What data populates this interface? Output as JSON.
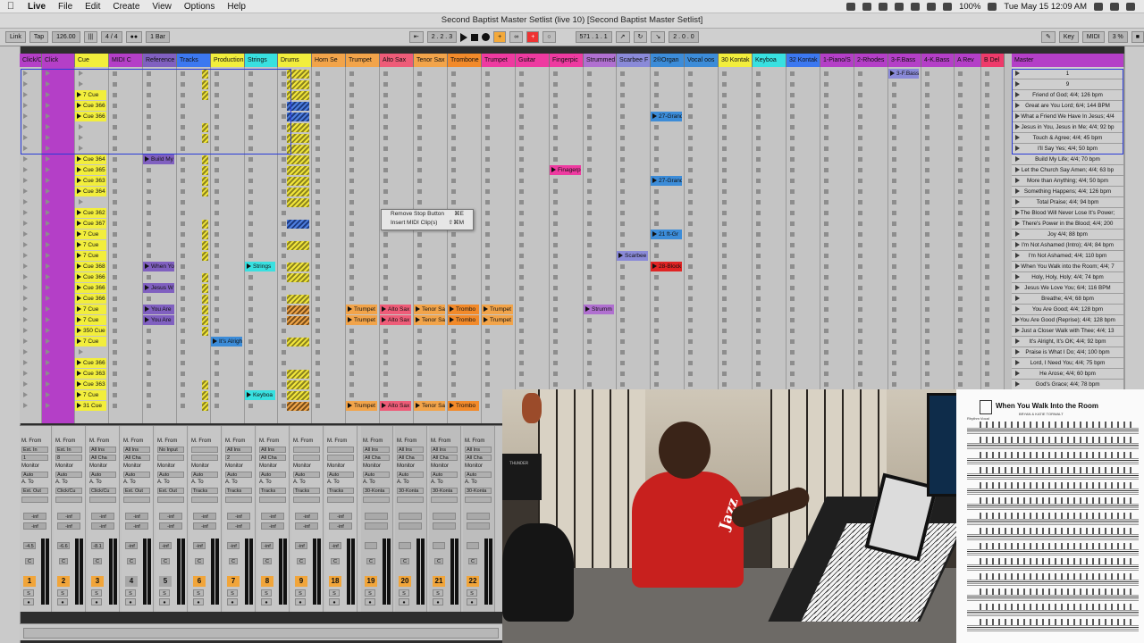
{
  "menubar": {
    "app": "Live",
    "items": [
      "File",
      "Edit",
      "Create",
      "View",
      "Options",
      "Help"
    ],
    "battery": "100%",
    "clock": "Tue May 15  12:09 AM"
  },
  "window_title": "Second Baptist Master Setlist  (live 10)  [Second Baptist Master Setlist]",
  "transport": {
    "link": "Link",
    "tap": "Tap",
    "tempo": "126.00",
    "signature": "4 / 4",
    "quantize": "1 Bar",
    "position": "2 .  2 .  3",
    "loop_start": "571 .  1 .  1",
    "loop_length": "2 .  0 .  0",
    "key": "Key",
    "midi": "MIDI",
    "cpu": "3 %"
  },
  "tracks": [
    {
      "name": "Click/C",
      "color": "#b43fc7"
    },
    {
      "name": "Click",
      "color": "#b43fc7"
    },
    {
      "name": "Cue",
      "color": "#f2ee3c"
    },
    {
      "name": "MIDI C",
      "color": "#b43fc7"
    },
    {
      "name": "Reference",
      "color": "#8060c0"
    },
    {
      "name": "Tracks",
      "color": "#3c78f0"
    },
    {
      "name": "Production",
      "color": "#f2ee3c"
    },
    {
      "name": "Strings",
      "color": "#38e0e0"
    },
    {
      "name": "Drums",
      "color": "#f2ee3c"
    },
    {
      "name": "Horn Se",
      "color": "#f2a44a"
    },
    {
      "name": "Trumpet",
      "color": "#f2a44a"
    },
    {
      "name": "Alto Sax",
      "color": "#ee5c78"
    },
    {
      "name": "Tenor Sax",
      "color": "#f2a44a"
    },
    {
      "name": "Trombone",
      "color": "#f28a2a"
    },
    {
      "name": "Trumpet",
      "color": "#ee3aa0"
    },
    {
      "name": "Guitar",
      "color": "#ee3aa0"
    },
    {
      "name": "Fingerpic",
      "color": "#ee3aa0"
    },
    {
      "name": "Strummed",
      "color": "#b070d0"
    },
    {
      "name": "Scarbee F",
      "color": "#8a8ad8"
    },
    {
      "name": "2®Organ",
      "color": "#3c8cd8"
    },
    {
      "name": "Vocal oos",
      "color": "#3c8cd8"
    },
    {
      "name": "30 Kontak",
      "color": "#f2ee3c"
    },
    {
      "name": "Keyboa",
      "color": "#38e0e0"
    },
    {
      "name": "32 Kontak",
      "color": "#3c78f0"
    },
    {
      "name": "1-Piano/S",
      "color": "#b43fc7"
    },
    {
      "name": "2-Rhodes",
      "color": "#b43fc7"
    },
    {
      "name": "3-F.Bass",
      "color": "#b43fc7"
    },
    {
      "name": "4-K.Bass",
      "color": "#b43fc7"
    },
    {
      "name": "A Rev",
      "color": "#b43fc7"
    },
    {
      "name": "B Del",
      "color": "#ee3a6a"
    },
    {
      "name": "Master",
      "color": "#b43fc7"
    }
  ],
  "clips": {
    "cue": [
      "7 Cue",
      "Cue 366",
      "Cue 366",
      "Cue 364",
      "Cue 365",
      "Cue 363",
      "Cue 364",
      "Cue 362",
      "Cue 367",
      "7 Cue",
      "7 Cue",
      "7 Cue",
      "Cue 368",
      "Cue 366",
      "Cue 366",
      "Cue 366",
      "7 Cue",
      "7 Cue",
      "350 Cue",
      "7 Cue",
      "Cue 366",
      "Cue 363",
      "Cue 363",
      "7 Cue",
      "31 Cue"
    ],
    "reference": [
      "Build My",
      "When Yo",
      "Jesus W",
      "You Are",
      "You Are"
    ],
    "production": "It's Alright",
    "strings": "Strings",
    "strings2": "Keyboa",
    "fingerpick": "Finagerp",
    "organ": [
      "27-Grand",
      "27-Grand",
      "21 ft-Gr",
      "28-Block"
    ],
    "scarbee": "Scarbee",
    "strummed": "Strumm",
    "horn_clip_labels": [
      "Trumpet",
      "Alto Sax",
      "Tenor Sa",
      "Trombo",
      "Trumpet"
    ],
    "fbass": "3-F.Bass"
  },
  "scenes": [
    "1",
    "9",
    "Friend of God; 4/4; 126 bpm",
    "Great are You Lord; 6/4; 144 BPM",
    "What a Friend We Have In Jesus; 4/4",
    "Jesus in You, Jesus in Me; 4/4; 92 bp",
    "Touch & Agree; 4/4; 45 bpm",
    "I'll Say Yes; 4/4; 50 bpm",
    "Build My Life; 4/4; 70 bpm",
    "Let the Church Say Amen; 4/4; 63 bp",
    "More than Anything; 4/4; 50 bpm",
    "Something Happens; 4/4; 126 bpm",
    "Total Praise; 4/4; 94 bpm",
    "The Blood Will Never Lose It's Power;",
    "There's Power in the Blood; 4/4; 200",
    "Joy 4/4; 88 bpm",
    "I'm Not Ashamed (Intro); 4/4; 84 bpm",
    "I'm Not Ashamed; 4/4; 110 bpm",
    "When You Walk into the Room; 4/4; 7",
    "Holy, Holy, Holy; 4/4; 74 bpm",
    "Jesus We Love You; 6/4; 116 BPM",
    "Breathe; 4/4; 68 bpm",
    "You Are Good; 4/4; 128 bpm",
    "You Are Good (Reprise); 4/4; 128 bpm",
    "Just a Closer Walk with Thee; 4/4; 13",
    "It's Alright, It's OK; 4/4; 92 bpm",
    "Praise is What I Do; 4/4; 100 bpm",
    "Lord, I Need You; 4/4; 75 bpm",
    "He Arose; 4/4; 60 bpm",
    "God's Grace; 4/4; 78 bpm"
  ],
  "context_menu": [
    {
      "label": "Remove Stop Button",
      "shortcut": "⌘E"
    },
    {
      "label": "Insert MIDI Clip(s)",
      "shortcut": "⇧⌘M"
    }
  ],
  "mixer": {
    "channels": [
      {
        "num": "1",
        "from": "Ext. In",
        "chan": "1",
        "to": "Ext. Out",
        "vol": "-inf",
        "db": "-4.5",
        "orange": true
      },
      {
        "num": "2",
        "from": "Ext. In",
        "chan": "8",
        "to": "Click/Cu",
        "vol": "-inf",
        "db": "-6.6",
        "orange": true
      },
      {
        "num": "3",
        "from": "All Ins",
        "chan": "All Cha",
        "to": "Click/Cu",
        "vol": "-inf",
        "db": "-8.1",
        "orange": true
      },
      {
        "num": "4",
        "from": "All Ins",
        "chan": "All Cha",
        "to": "Ext. Out",
        "vol": "-inf",
        "db": "-inf",
        "orange": false
      },
      {
        "num": "5",
        "from": "No Input",
        "chan": "",
        "to": "Ext. Out",
        "vol": "-inf",
        "db": "-inf",
        "orange": false
      },
      {
        "num": "6",
        "from": "",
        "chan": "",
        "to": "Tracks",
        "vol": "-inf",
        "db": "-inf",
        "orange": true
      },
      {
        "num": "7",
        "from": "All Ins",
        "chan": "2",
        "to": "Tracks",
        "vol": "-inf",
        "db": "-inf",
        "orange": true
      },
      {
        "num": "8",
        "from": "All Ins",
        "chan": "All Cha",
        "to": "Tracks",
        "vol": "-inf",
        "db": "-inf",
        "orange": true
      },
      {
        "num": "9",
        "from": "",
        "chan": "",
        "to": "Tracks",
        "vol": "-inf",
        "db": "-inf",
        "orange": true
      },
      {
        "num": "18",
        "from": "",
        "chan": "",
        "to": "Tracks",
        "vol": "-inf",
        "db": "-inf",
        "orange": true
      },
      {
        "num": "19",
        "from": "All Ins",
        "chan": "All Cha",
        "to": "30-Konta",
        "vol": "",
        "db": "",
        "orange": true
      },
      {
        "num": "20",
        "from": "All Ins",
        "chan": "All Cha",
        "to": "30-Konta",
        "vol": "",
        "db": "",
        "orange": true
      },
      {
        "num": "21",
        "from": "All Ins",
        "chan": "All Cha",
        "to": "30-Konta",
        "vol": "",
        "db": "",
        "orange": true
      },
      {
        "num": "22",
        "from": "All Ins",
        "chan": "All Cha",
        "to": "30-Konta",
        "vol": "",
        "db": "",
        "orange": true
      }
    ],
    "labels": {
      "from": "M. From",
      "monitor": "Monitor",
      "auto": "Auto",
      "to": "A. To"
    }
  },
  "sheet": {
    "title": "When You Walk Into the Room",
    "byline": "BRYAN & KATIE TORWALT",
    "section": "Rhythm Vocal"
  },
  "webcam": {
    "shirt_text": "Jazz",
    "amp_text": "THUNDER"
  }
}
